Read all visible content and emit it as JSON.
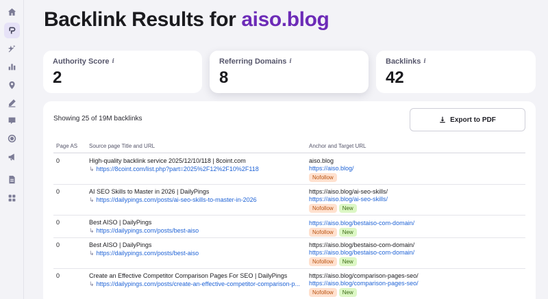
{
  "sidebar": {
    "items": [
      {
        "icon": "home-icon",
        "active": false
      },
      {
        "icon": "backlinks-icon",
        "active": true
      },
      {
        "icon": "sparkle-icon",
        "active": false
      },
      {
        "icon": "bar-chart-icon",
        "active": false
      },
      {
        "icon": "map-pin-icon",
        "active": false
      },
      {
        "icon": "pencil-icon",
        "active": false
      },
      {
        "icon": "heart-chat-icon",
        "active": false
      },
      {
        "icon": "target-icon",
        "active": false
      },
      {
        "icon": "megaphone-icon",
        "active": false
      },
      {
        "icon": "document-icon",
        "active": false
      },
      {
        "icon": "grid-icon",
        "active": false
      }
    ]
  },
  "header": {
    "title_prefix": "Backlink Results for",
    "domain": "aiso.blog"
  },
  "stats": [
    {
      "label": "Authority Score",
      "info": "i",
      "value": "2"
    },
    {
      "label": "Referring Domains",
      "info": "i",
      "value": "8"
    },
    {
      "label": "Backlinks",
      "info": "i",
      "value": "42"
    }
  ],
  "results": {
    "showing_text": "Showing 25 of 19M backlinks",
    "export_label": "Export to PDF",
    "columns": {
      "page_as": "Page AS",
      "source": "Source page Title and URL",
      "anchor": "Anchor and Target URL"
    },
    "arrow": "↳",
    "rows": [
      {
        "page_as": "0",
        "title": "High-quality backlink service 2025/12/10/118 | 8coint.com",
        "url": "https://8coint.com/list.php?part=2025%2F12%2F10%2F118",
        "anchor": "aiso.blog",
        "target": "https://aiso.blog/",
        "badges": [
          "Nofollow"
        ]
      },
      {
        "page_as": "0",
        "title": "AI SEO Skills to Master in 2026 | DailyPings",
        "url": "https://dailypings.com/posts/ai-seo-skills-to-master-in-2026",
        "anchor": "https://aiso.blog/ai-seo-skills/",
        "target": "https://aiso.blog/ai-seo-skills/",
        "badges": [
          "Nofollow",
          "New"
        ]
      },
      {
        "page_as": "0",
        "title": "Best AISO | DailyPings",
        "url": "https://dailypings.com/posts/best-aiso",
        "anchor": "",
        "target": "https://aiso.blog/bestaiso-com-domain/",
        "badges": [
          "Nofollow",
          "New"
        ]
      },
      {
        "page_as": "0",
        "title": "Best AISO | DailyPings",
        "url": "https://dailypings.com/posts/best-aiso",
        "anchor": "https://aiso.blog/bestaiso-com-domain/",
        "target": "https://aiso.blog/bestaiso-com-domain/",
        "badges": [
          "Nofollow",
          "New"
        ]
      },
      {
        "page_as": "0",
        "title": "Create an Effective Competitor Comparison Pages For SEO | DailyPings",
        "url": "https://dailypings.com/posts/create-an-effective-competitor-comparison-p...",
        "anchor": "https://aiso.blog/comparison-pages-seo/",
        "target": "https://aiso.blog/comparison-pages-seo/",
        "badges": [
          "Nofollow",
          "New"
        ]
      }
    ]
  },
  "colors": {
    "accent": "#6c2bb7",
    "link": "#1f63d6",
    "nofollow_bg": "#ffe1cf",
    "new_bg": "#dcf7c5"
  }
}
